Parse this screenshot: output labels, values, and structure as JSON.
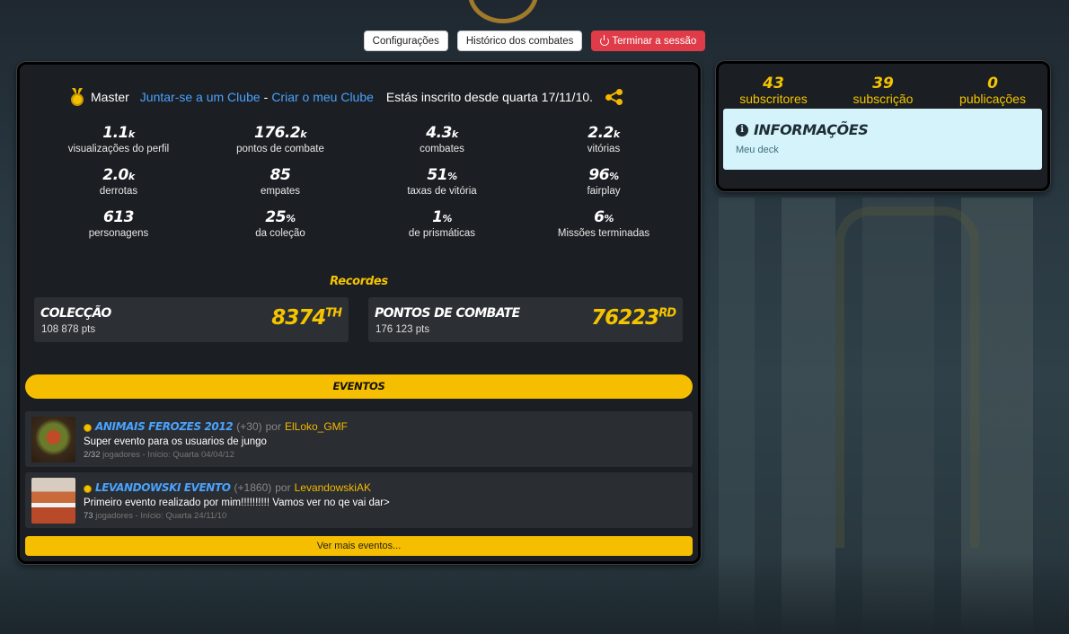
{
  "topbar": {
    "settings_label": "Configurações",
    "history_label": "Histórico dos combates",
    "logout_label": "Terminar a sessão"
  },
  "profile": {
    "rank": "Master",
    "join_club": "Juntar-se a um Clube",
    "separator": "-",
    "create_club": "Criar o meu Clube",
    "member_since": "Estás inscrito desde quarta 17/11/10."
  },
  "stats": [
    {
      "value": "1.1",
      "suffix": "k",
      "label": "visualizações do perfil"
    },
    {
      "value": "176.2",
      "suffix": "k",
      "label": "pontos de combate"
    },
    {
      "value": "4.3",
      "suffix": "k",
      "label": "combates"
    },
    {
      "value": "2.2",
      "suffix": "k",
      "label": "vitórias"
    },
    {
      "value": "2.0",
      "suffix": "k",
      "label": "derrotas"
    },
    {
      "value": "85",
      "suffix": "",
      "label": "empates"
    },
    {
      "value": "51",
      "suffix": "%",
      "label": "taxas de vitória"
    },
    {
      "value": "96",
      "suffix": "%",
      "label": "fairplay"
    },
    {
      "value": "613",
      "suffix": "",
      "label": "personagens"
    },
    {
      "value": "25",
      "suffix": "%",
      "label": "da coleção"
    },
    {
      "value": "1",
      "suffix": "%",
      "label": "de prismáticas"
    },
    {
      "value": "6",
      "suffix": "%",
      "label": "Missões terminadas"
    }
  ],
  "records": {
    "title": "Recordes",
    "items": [
      {
        "name": "Colecção",
        "pts": "108 878 pts",
        "rank": "8374",
        "ordinal": "TH"
      },
      {
        "name": "Pontos de combate",
        "pts": "176 123 pts",
        "rank": "76223",
        "ordinal": "RD"
      }
    ]
  },
  "events": {
    "title": "Eventos",
    "items": [
      {
        "title": "Animais Ferozes 2012",
        "bonus": "(+30)",
        "by": "por",
        "author": "ElLoko_GMF",
        "desc": "Super evento para os usuarios de jungo",
        "players": "2/32",
        "meta": "jogadores - Início: Quarta 04/04/12"
      },
      {
        "title": "Levandowski Evento",
        "bonus": "(+1860)",
        "by": "por",
        "author": "LevandowskiAK",
        "desc": "Primeiro evento realizado por mim!!!!!!!!!! Vamos ver no qe vai dar>",
        "players": "73",
        "meta": "jogadores - Início: Quarta 24/11/10"
      }
    ],
    "more_label": "Ver mais eventos..."
  },
  "side": {
    "stats": [
      {
        "value": "43",
        "label": "subscritores"
      },
      {
        "value": "39",
        "label": "subscrição"
      },
      {
        "value": "0",
        "label": "publicações"
      }
    ],
    "info_title": "Informações",
    "info_link": "Meu deck"
  },
  "colors": {
    "accent_yellow": "#f5be00",
    "link_blue": "#4aa3ff",
    "danger_red": "#e03b48",
    "panel_bg": "#1b1e22"
  }
}
